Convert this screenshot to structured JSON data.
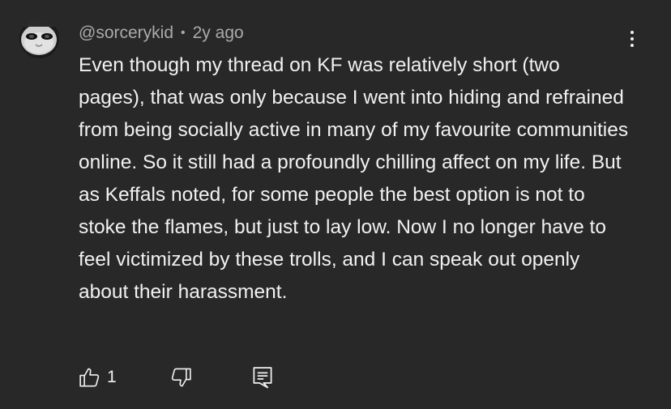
{
  "comment": {
    "author": "@sorcerykid",
    "separator": "•",
    "time": "2y ago",
    "text": "Even though my thread on KF was relatively short (two pages), that was only because I went into hiding and refrained from being socially active in many of my favourite communities online. So it still had a profoundly chilling affect on my life. But as Keffals noted, for some people the best option is not to stoke the flames, but just to lay low. Now I no longer have to feel victimized by these trolls, and I can speak out openly about their harassment.",
    "like_count": "1"
  },
  "icons": {
    "avatar": "avatar-image",
    "like": "thumbs-up-icon",
    "dislike": "thumbs-down-icon",
    "reply": "reply-comment-icon",
    "menu": "more-vertical-icon"
  },
  "colors": {
    "background": "#282828",
    "text": "#f1f1f1",
    "meta": "#aaaaaa"
  }
}
